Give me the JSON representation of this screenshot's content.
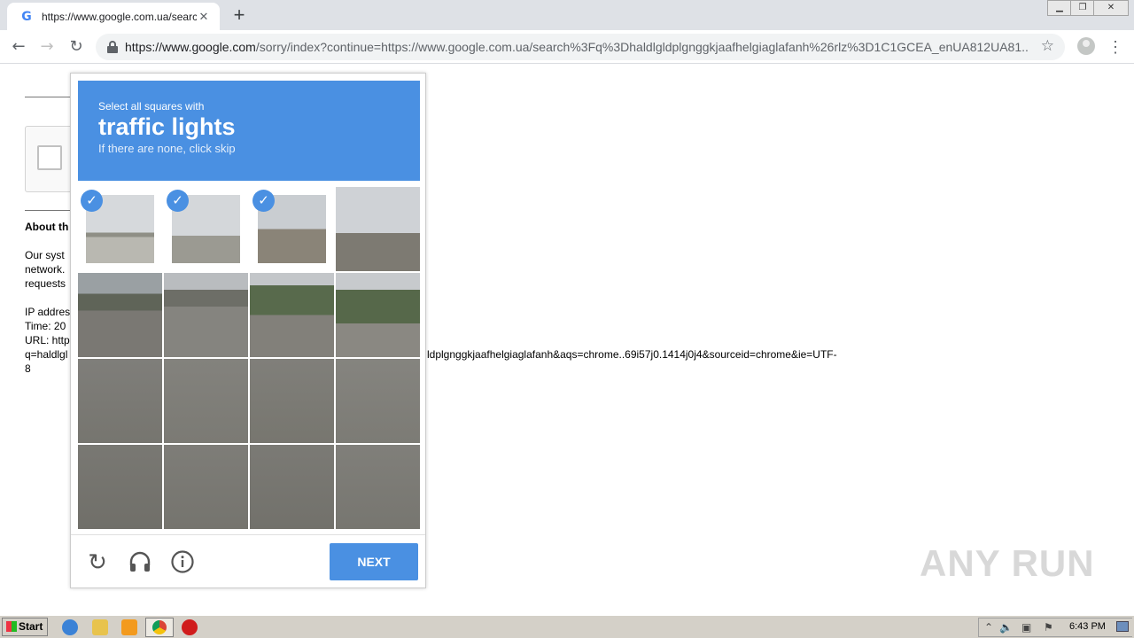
{
  "browser": {
    "tab_title": "https://www.google.com.ua/search?",
    "tab_favicon": "G",
    "url_host": "https://www.google.com",
    "url_rest": "/sorry/index?continue=https://www.google.com.ua/search%3Fq%3Dhaldlgldplgnggkjaafhelgiaglafanh%26rlz%3D1C1GCEA_enUA812UA81..."
  },
  "page": {
    "about_heading": "About th",
    "line1": "Our syst",
    "line2": "network.",
    "line3": "requests",
    "ip": "IP addres",
    "time": "Time: 20",
    "url_label": "URL: http",
    "url_q": "q=haldlgl",
    "url_tail": "ldplgnggkjaafhelgiaglafanh&aqs=chrome..69i57j0.1414j0j4&sourceid=chrome&ie=UTF-",
    "url_tail2": "8"
  },
  "captcha": {
    "instruction": "Select all squares with",
    "target": "traffic lights",
    "hint": "If there are none, click skip",
    "next_label": "NEXT",
    "selected_tiles": [
      0,
      1,
      2
    ]
  },
  "watermark": "ANY RUN",
  "taskbar": {
    "start_label": "Start",
    "clock": "6:43 PM"
  }
}
